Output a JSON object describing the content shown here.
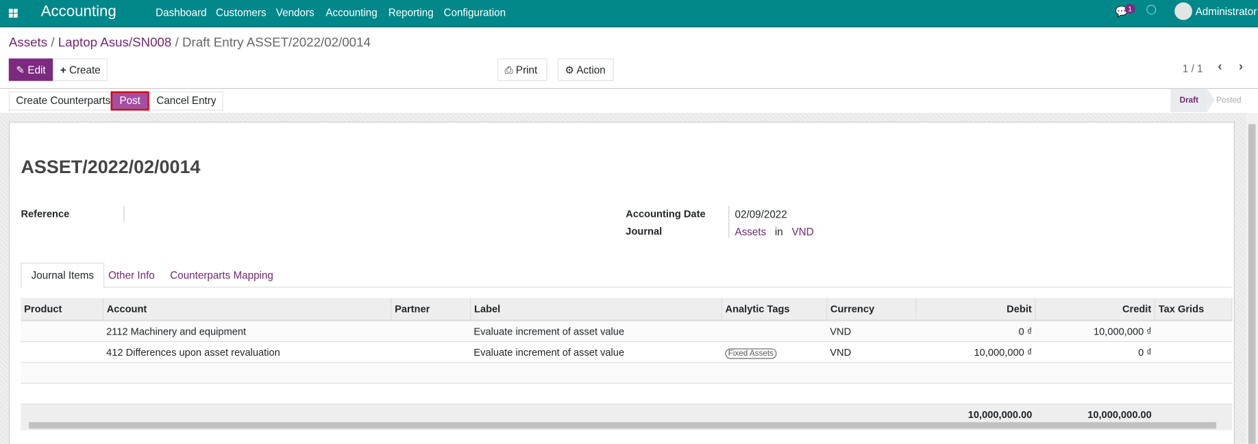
{
  "navbar": {
    "app_title": "Accounting",
    "menu": [
      "Dashboard",
      "Customers",
      "Vendors",
      "Accounting",
      "Reporting",
      "Configuration"
    ],
    "message_count": "1",
    "user": "Administrator"
  },
  "breadcrumb": {
    "items": [
      "Assets",
      "Laptop Asus/SN008"
    ],
    "current": "Draft Entry ASSET/2022/02/0014",
    "sep": "/"
  },
  "toolbar": {
    "edit": "Edit",
    "create": "Create",
    "print": "Print",
    "action": "Action",
    "pager": "1 / 1"
  },
  "actions": {
    "create_counterparts": "Create Counterparts",
    "post": "Post",
    "cancel_entry": "Cancel Entry"
  },
  "status": {
    "stages": [
      "Draft",
      "Posted"
    ],
    "current": "Draft"
  },
  "form": {
    "title": "ASSET/2022/02/0014",
    "reference_label": "Reference",
    "reference": "",
    "date_label": "Accounting Date",
    "date": "02/09/2022",
    "journal_label": "Journal",
    "journal": "Assets",
    "journal_in": "in",
    "journal_currency": "VND"
  },
  "tabs": [
    "Journal Items",
    "Other Info",
    "Counterparts Mapping"
  ],
  "table": {
    "headers": [
      "Product",
      "Account",
      "Partner",
      "Label",
      "Analytic Tags",
      "Currency",
      "Debit",
      "Credit",
      "Tax Grids"
    ],
    "rows": [
      {
        "product": "",
        "account": "2112 Machinery and equipment",
        "partner": "",
        "label": "Evaluate increment of asset value",
        "tags": "",
        "currency": "VND",
        "debit": "0 ₫",
        "credit": "10,000,000 ₫"
      },
      {
        "product": "",
        "account": "412 Differences upon asset revaluation",
        "partner": "",
        "label": "Evaluate increment of asset value",
        "tags": "Fixed Assets",
        "currency": "VND",
        "debit": "10,000,000 ₫",
        "credit": "0 ₫"
      }
    ],
    "total_debit": "10,000,000.00",
    "total_credit": "10,000,000.00"
  },
  "colors": {
    "navbar": "#00878a",
    "primary": "#7c2a7f",
    "highlight": "#e00000"
  }
}
